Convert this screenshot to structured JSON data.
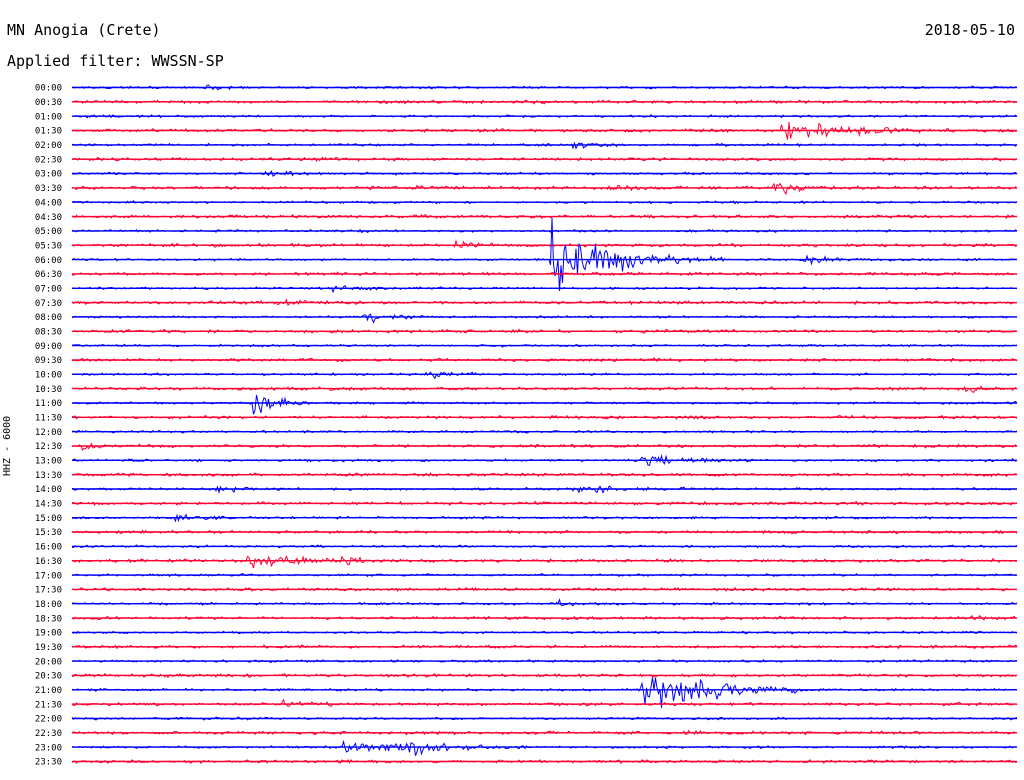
{
  "header": {
    "station": "MN Anogia (Crete)",
    "filter": "Applied filter: WWSSN-SP",
    "date": "2018-05-10"
  },
  "channel": "HHZ - 6000",
  "colors": {
    "even_trace": "#0000ff",
    "odd_trace": "#ff0033"
  },
  "chart_data": {
    "type": "line",
    "title": "MN Anogia (Crete)",
    "ylabel": "HHZ - 6000",
    "y_tick_labels": [
      "00:00",
      "00:30",
      "01:00",
      "01:30",
      "02:00",
      "02:30",
      "03:00",
      "03:30",
      "04:00",
      "04:30",
      "05:00",
      "05:30",
      "06:00",
      "06:30",
      "07:00",
      "07:30",
      "08:00",
      "08:30",
      "09:00",
      "09:30",
      "10:00",
      "10:30",
      "11:00",
      "11:30",
      "12:00",
      "12:30",
      "13:00",
      "13:30",
      "14:00",
      "14:30",
      "15:00",
      "15:30",
      "16:00",
      "16:30",
      "17:00",
      "17:30",
      "18:00",
      "18:30",
      "19:00",
      "19:30",
      "20:00",
      "20:30",
      "21:00",
      "21:30",
      "22:00",
      "22:30",
      "23:00",
      "23:30"
    ],
    "x_range_minutes": [
      0,
      30
    ],
    "grid": false,
    "legend": "none",
    "events": [
      {
        "line": "00:00",
        "minute": 4.2,
        "amplitude": 0.3
      },
      {
        "line": "01:30",
        "minute": 22.5,
        "amplitude": 1.6,
        "duration": 2.2
      },
      {
        "line": "02:00",
        "minute": 15.9,
        "amplitude": 0.6
      },
      {
        "line": "03:00",
        "minute": 6.1,
        "amplitude": 0.7
      },
      {
        "line": "03:30",
        "minute": 10.9,
        "amplitude": 0.5
      },
      {
        "line": "03:30",
        "minute": 16.8,
        "amplitude": 0.4
      },
      {
        "line": "03:30",
        "minute": 22.3,
        "amplitude": 1.2
      },
      {
        "line": "05:30",
        "minute": 12.2,
        "amplitude": 0.6
      },
      {
        "line": "06:00",
        "minute": 15.2,
        "amplitude": 6.5,
        "duration": 2.2
      },
      {
        "line": "06:00",
        "minute": 23.3,
        "amplitude": 0.7
      },
      {
        "line": "07:00",
        "minute": 8.3,
        "amplitude": 0.6
      },
      {
        "line": "07:30",
        "minute": 6.5,
        "amplitude": 0.5
      },
      {
        "line": "08:00",
        "minute": 9.3,
        "amplitude": 1.3
      },
      {
        "line": "10:00",
        "minute": 11.3,
        "amplitude": 0.8
      },
      {
        "line": "10:30",
        "minute": 28.2,
        "amplitude": 0.5
      },
      {
        "line": "11:00",
        "minute": 5.7,
        "amplitude": 2.4
      },
      {
        "line": "12:30",
        "minute": 0.3,
        "amplitude": 0.4
      },
      {
        "line": "13:00",
        "minute": 18.1,
        "amplitude": 0.9,
        "duration": 1.6
      },
      {
        "line": "14:00",
        "minute": 4.6,
        "amplitude": 0.6
      },
      {
        "line": "14:00",
        "minute": 15.9,
        "amplitude": 0.6,
        "duration": 2.2
      },
      {
        "line": "15:00",
        "minute": 3.3,
        "amplitude": 0.7
      },
      {
        "line": "16:30",
        "minute": 5.6,
        "amplitude": 1.2,
        "duration": 1.8
      },
      {
        "line": "16:30",
        "minute": 8.5,
        "amplitude": 0.7
      },
      {
        "line": "18:00",
        "minute": 15.4,
        "amplitude": 0.5
      },
      {
        "line": "18:30",
        "minute": 28.3,
        "amplitude": 0.3
      },
      {
        "line": "21:00",
        "minute": 18.1,
        "amplitude": 3.8,
        "duration": 2.4
      },
      {
        "line": "21:30",
        "minute": 6.7,
        "amplitude": 0.5
      },
      {
        "line": "23:00",
        "minute": 8.6,
        "amplitude": 1.0,
        "duration": 2.4
      },
      {
        "line": "23:00",
        "minute": 10.5,
        "amplitude": 1.1,
        "duration": 1.6
      }
    ]
  }
}
